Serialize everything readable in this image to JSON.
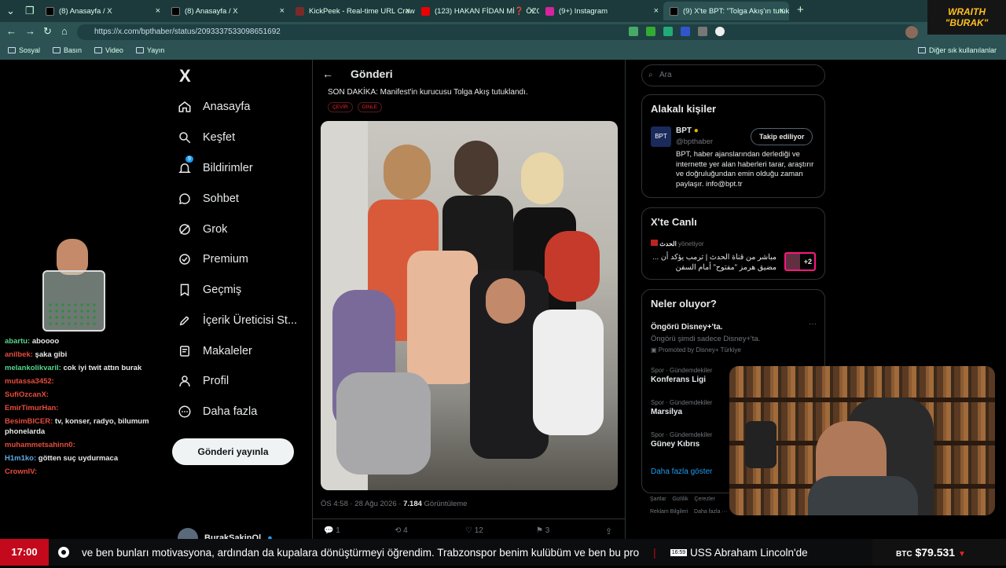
{
  "browser": {
    "tabs": [
      {
        "title": "(8) Anasayfa / X",
        "color": "#000"
      },
      {
        "title": "(8) Anasayfa / X",
        "color": "#000"
      },
      {
        "title": "KickPeek - Real-time URL Crawler",
        "color": "#7b2a2a"
      },
      {
        "title": "(123) HAKAN FİDAN Mİ❓ ÖZGÜ",
        "color": "#e00"
      },
      {
        "title": "(9+) Instagram",
        "color": "#d6249f"
      },
      {
        "title": "(9) X'te BPT: \"Tolga Akış'ın tutukla",
        "color": "#000"
      }
    ],
    "url": "https://x.com/bpthaber/status/2093337533098651692",
    "bookmarks": [
      "Sosyal",
      "Basın",
      "Video",
      "Yayın"
    ],
    "other_bookmarks": "Diğer sık kullanılanlar"
  },
  "overlay": {
    "wraith_line1": "WRAITH",
    "wraith_line2": "\"BURAK\""
  },
  "nav": {
    "logo": "X",
    "items": [
      "Anasayfa",
      "Keşfet",
      "Bildirimler",
      "Sohbet",
      "Grok",
      "Premium",
      "Geçmiş",
      "İçerik Üreticisi St...",
      "Makaleler",
      "Profil",
      "Daha fazla"
    ],
    "notif_badge": "9",
    "post_button": "Gönderi yayınla",
    "user": "BurakSakinOl"
  },
  "post": {
    "header": "Gönderi",
    "text": "SON DAKİKA: Manifest'in kurucusu Tolga Akış tutuklandı.",
    "tag1": "ÇEVİR",
    "tag2": "DİNLE",
    "time": "ÖS 4:58 · 28 Ağu 2026 ·",
    "views": "7.184",
    "views_label": "Görüntüleme",
    "replies": "1",
    "reposts": "4",
    "likes": "12",
    "bookmarks": "3"
  },
  "right": {
    "search_placeholder": "Ara",
    "related_title": "Alakalı kişiler",
    "related_name": "BPT",
    "related_handle": "@bpthaber",
    "follow_label": "Takip ediliyor",
    "related_bio": "BPT, haber ajanslarından derlediği ve internette yer alan haberleri tarar, araştırır ve doğruluğundan emin olduğu zaman paylaşır. info@bpt.tr",
    "live_title": "X'te Canlı",
    "live_source": "الحدث",
    "live_status": "yönetiyor",
    "live_text": "مباشر من قناة الحدث | ترمب يؤكد أن ... مضيق هرمز \"مفتوح\" أمام السفن",
    "live_count": "+2",
    "trends_title": "Neler oluyor?",
    "promo_title": "Öngörü Disney+'ta.",
    "promo_sub": "Öngörü şimdi sadece Disney+'ta.",
    "promo_by": "Promoted by Disney+ Türkiye",
    "trends": [
      {
        "cat": "Spor · Gündemdekiler",
        "name": "Konferans Ligi"
      },
      {
        "cat": "Spor · Gündemdekiler",
        "name": "Marsilya"
      },
      {
        "cat": "Spor · Gündemdekiler",
        "name": "Güney Kıbrıs"
      }
    ],
    "show_more": "Daha fazla göster",
    "footer1": "Şartlar    Gizlilik    Çerezler",
    "footer2": "Reklam Bilgileri    Daha fazla ···    © 2026 X Corp."
  },
  "chat": [
    {
      "user": "abartu:",
      "msg": "aboooo",
      "color": "#58d68d"
    },
    {
      "user": "anilbek:",
      "msg": "şaka gibi",
      "color": "#e74c3c"
    },
    {
      "user": "melankolikvaril:",
      "msg": "cok iyi twit attın burak",
      "color": "#58d68d"
    },
    {
      "user": "mutassa3452:",
      "msg": "",
      "color": "#e74c3c"
    },
    {
      "user": "SufiOzcanX:",
      "msg": "",
      "color": "#e74c3c"
    },
    {
      "user": "EmirTimurHan:",
      "msg": "",
      "color": "#e74c3c"
    },
    {
      "user": "BesimBICER:",
      "msg": "tv, konser, radyo, bilumum phonelarda",
      "color": "#e74c3c"
    },
    {
      "user": "muhammetsahinn0:",
      "msg": "",
      "color": "#e74c3c"
    },
    {
      "user": "H1m1ko:",
      "msg": "götten suç uydurmaca",
      "color": "#5dade2"
    },
    {
      "user": "CrownIV:",
      "msg": "",
      "color": "#e74c3c"
    }
  ],
  "ticker": {
    "time": "17:00",
    "text": "ve ben bunları motivasyona, ardından da kupalara dönüştürmeyi öğrendim. Trabzonspor benim kulübüm ve ben bu pro",
    "sep": "|",
    "clock": "16:59",
    "text2": "USS Abraham Lincoln'de",
    "btc_label": "BTC",
    "btc_value": "$79.531"
  }
}
